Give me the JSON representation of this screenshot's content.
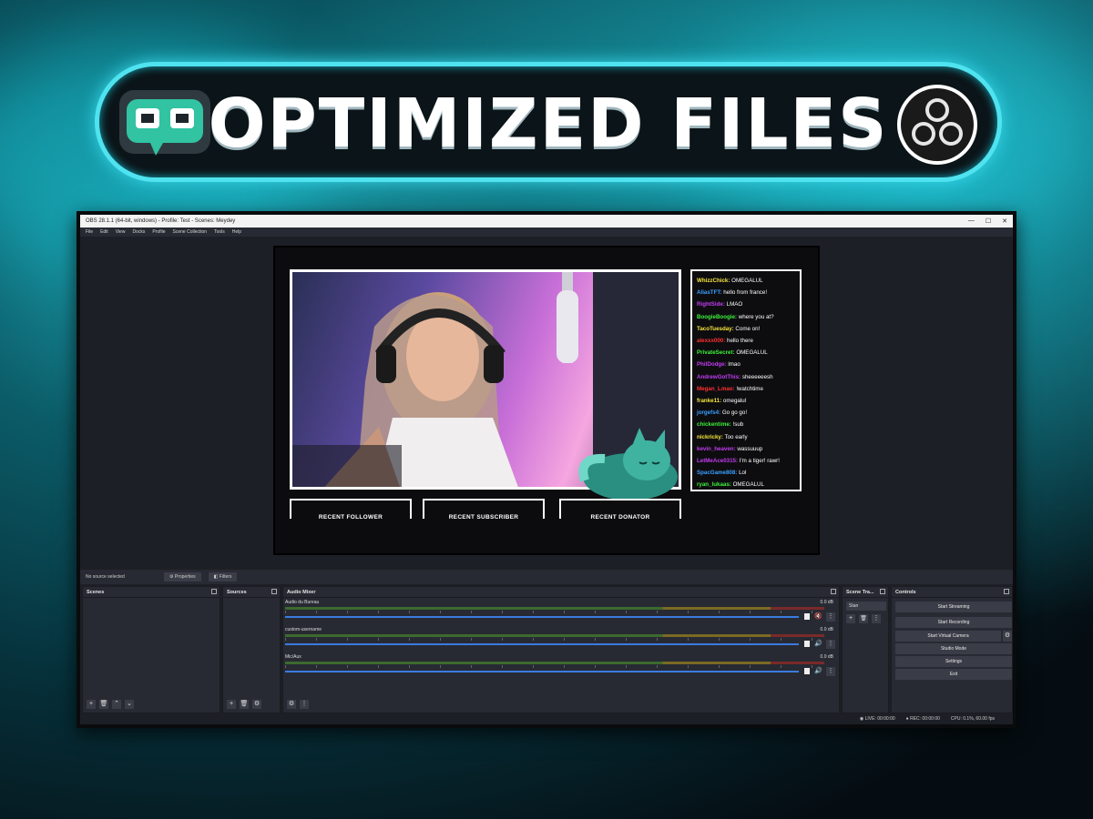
{
  "banner": {
    "title": "OPTIMIZED FILES"
  },
  "window": {
    "title": "OBS 28.1.1 (64-bit, windows) - Profile: Test - Scenes: Meydey",
    "menu": [
      "File",
      "Edit",
      "View",
      "Docks",
      "Profile",
      "Scene Collection",
      "Tools",
      "Help"
    ]
  },
  "overlay": {
    "chat": [
      {
        "user": "WhizzChick:",
        "msg": " OMEGALUL",
        "color": "#f6e53a"
      },
      {
        "user": "AliasTFT:",
        "msg": " hello from france!",
        "color": "#3aa0ff"
      },
      {
        "user": "RightSide:",
        "msg": " LMAO",
        "color": "#c23cf0"
      },
      {
        "user": "BoogieBoogie:",
        "msg": " where you at?",
        "color": "#3ef03a"
      },
      {
        "user": "TacoTuesday:",
        "msg": " Come on!",
        "color": "#f6e53a"
      },
      {
        "user": "alexxx000:",
        "msg": " hello there",
        "color": "#ff3030"
      },
      {
        "user": "PrivateSecret:",
        "msg": " OMEGALUL",
        "color": "#3ef03a"
      },
      {
        "user": "PhilDodge:",
        "msg": " lmao",
        "color": "#c23cf0"
      },
      {
        "user": "AndrewGotThis:",
        "msg": " sheeeeeesh",
        "color": "#c23cf0"
      },
      {
        "user": "Megan_Lmao:",
        "msg": " !watchtime",
        "color": "#ff3030"
      },
      {
        "user": "franke11:",
        "msg": " omegalul",
        "color": "#f6e53a"
      },
      {
        "user": "jorgefs4:",
        "msg": " Go go go!",
        "color": "#3aa0ff"
      },
      {
        "user": "chickentime:",
        "msg": " !sub",
        "color": "#3ef03a"
      },
      {
        "user": "nickricky:",
        "msg": " Too early",
        "color": "#f6e53a"
      },
      {
        "user": "kevin_heaven:",
        "msg": " wassuuup",
        "color": "#c23cf0"
      },
      {
        "user": "LetMeAce0315:",
        "msg": " I'm a tiger! rawr!",
        "color": "#c23cf0"
      },
      {
        "user": "SpacGame808:",
        "msg": " Lol",
        "color": "#3aa0ff"
      },
      {
        "user": "ryan_lukaas:",
        "msg": " OMEGALUL",
        "color": "#3ef03a"
      }
    ],
    "boxes": [
      "RECENT FOLLOWER",
      "RECENT SUBSCRIBER",
      "RECENT DONATOR"
    ]
  },
  "source_bar": {
    "status": "No source selected",
    "properties": "Properties",
    "filters": "Filters"
  },
  "docks": {
    "scenes": "Scenes",
    "sources": "Sources",
    "mixer": "Audio Mixer",
    "transitions": "Scene Tra...",
    "transition_value": "Stan",
    "controls": "Controls"
  },
  "mixer_channels": [
    {
      "name": "Audio du Bureau",
      "db": "0.0 dB"
    },
    {
      "name": "custom-username",
      "db": "0.0 dB"
    },
    {
      "name": "Mic/Aux",
      "db": "0.0 dB"
    }
  ],
  "controls": [
    "Start Streaming",
    "Start Recording",
    "Start Virtual Camera",
    "Studio Mode",
    "Settings",
    "Exit"
  ],
  "status": {
    "live": "LIVE: 00:00:00",
    "rec": "REC: 00:00:00",
    "cpu": "CPU: 0.1%, 60.00 fps"
  }
}
